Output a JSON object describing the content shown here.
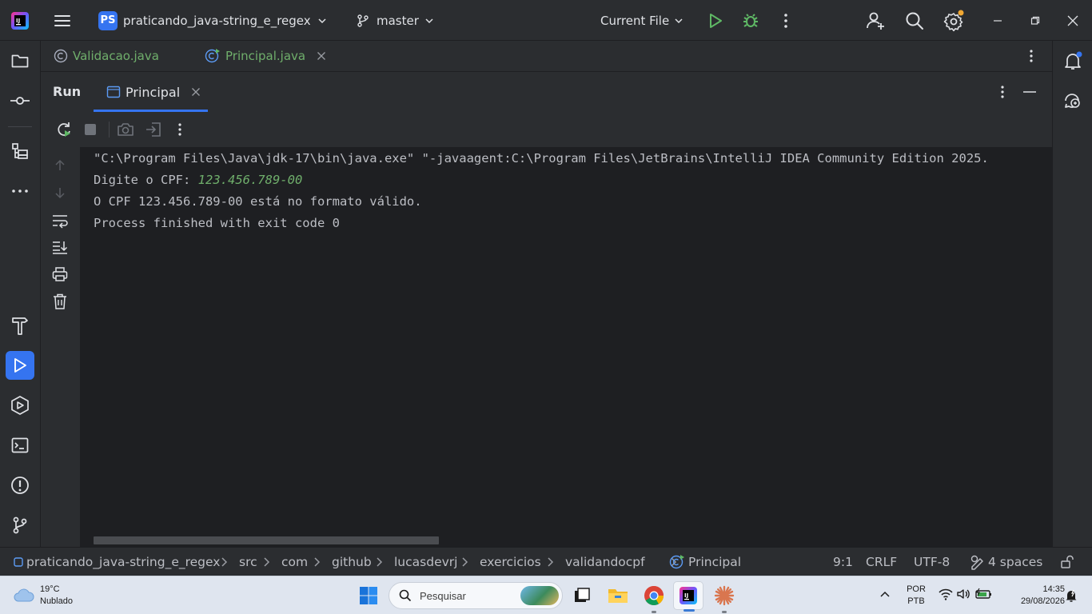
{
  "titlebar": {
    "project_badge": "PS",
    "project_name": "praticando_java-string_e_regex",
    "branch": "master",
    "run_config": "Current File"
  },
  "editor_tabs": [
    {
      "label": "Validacao.java"
    },
    {
      "label": "Principal.java"
    }
  ],
  "run_panel": {
    "title": "Run",
    "tab_label": "Principal"
  },
  "console": {
    "line1": "\"C:\\Program Files\\Java\\jdk-17\\bin\\java.exe\" \"-javaagent:C:\\Program Files\\JetBrains\\IntelliJ IDEA Community Edition 2025.",
    "line2_prompt": "Digite o CPF: ",
    "line2_input": "123.456.789-00",
    "line3": "O CPF 123.456.789-00 está no formato válido.",
    "line4": "Process finished with exit code 0"
  },
  "statusbar": {
    "breadcrumbs": [
      "praticando_java-string_e_regex",
      "src",
      "com",
      "github",
      "lucasdevrj",
      "exercicios",
      "validandocpf",
      "Principal"
    ],
    "position": "9:1",
    "line_ending": "CRLF",
    "encoding": "UTF-8",
    "indent": "4 spaces"
  },
  "taskbar": {
    "weather_temp": "19°C",
    "weather_desc": "Nublado",
    "search_placeholder": "Pesquisar",
    "lang_top": "POR",
    "lang_bottom": "PTB",
    "time": "14:35",
    "date": "29/08/2026"
  },
  "colors": {
    "accent": "#3574f0",
    "run_green": "#5fb865",
    "console_input": "#6fae6b",
    "notify_dot": "#f0a732"
  }
}
